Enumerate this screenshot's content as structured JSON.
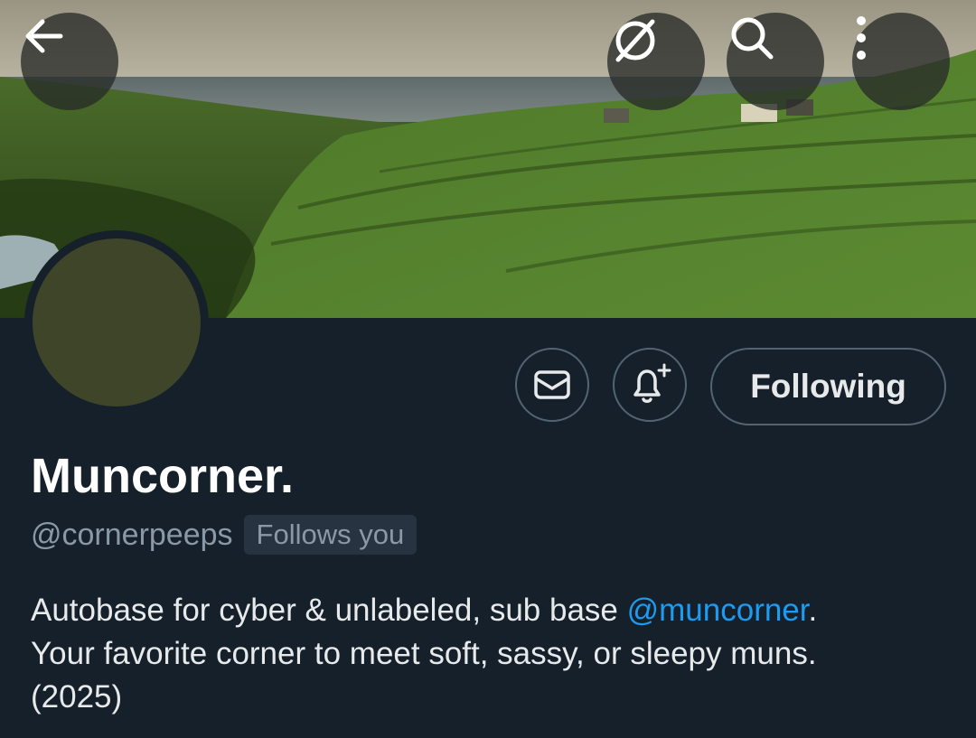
{
  "header": {
    "back_icon": "arrow-left-icon",
    "grok_icon": "grok-slash-icon",
    "search_icon": "search-icon",
    "more_icon": "more-vertical-icon"
  },
  "profile": {
    "avatar_color": "#3f4529",
    "display_name": "Muncorner.",
    "handle": "@cornerpeeps",
    "follows_you_label": "Follows you",
    "bio_before": "Autobase for cyber & unlabeled, sub base ",
    "bio_mention": "@muncorner",
    "bio_after": ".\nYour favorite corner to meet soft, sassy, or sleepy muns.\n(2025)"
  },
  "actions": {
    "message_icon": "envelope-icon",
    "notify_icon": "bell-plus-icon",
    "following_label": "Following"
  },
  "colors": {
    "background": "#15202b",
    "accent": "#1d9bf0",
    "muted_text": "#8b98a5",
    "button_border": "#536471"
  }
}
